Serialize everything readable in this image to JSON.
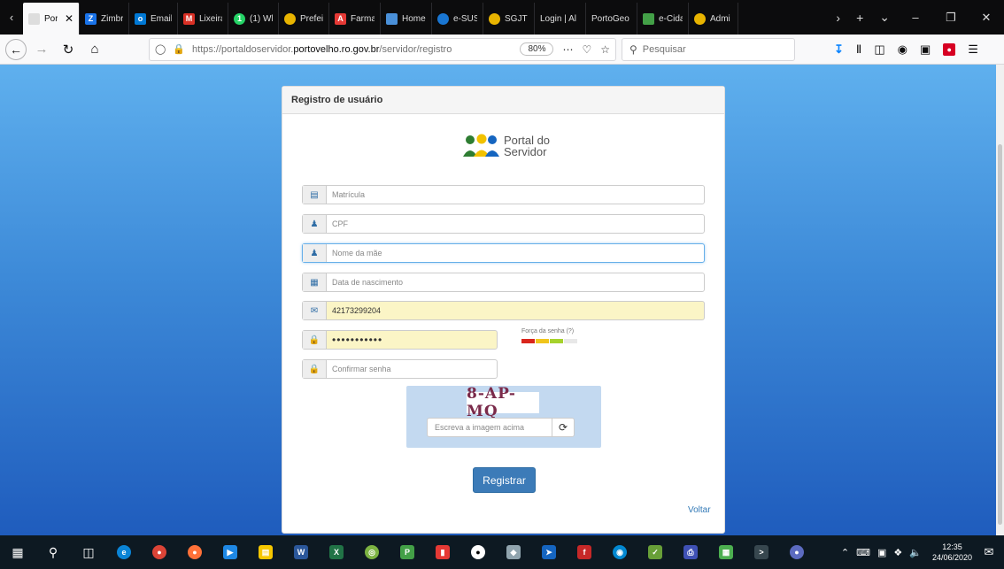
{
  "browser": {
    "tabs": [
      {
        "label": "Portal",
        "icon": "portal-icon",
        "active": true,
        "fav_color": "#f9f9fa"
      },
      {
        "label": "Zimbr",
        "icon": "zimbra-icon",
        "fav_color": "#1a73e8"
      },
      {
        "label": "Email",
        "icon": "outlook-icon",
        "fav_color": "#0078d4"
      },
      {
        "label": "Lixeira",
        "icon": "gmail-icon",
        "fav_color": "#d93025"
      },
      {
        "label": "(1) Wh",
        "icon": "whatsapp-icon",
        "fav_color": "#25d366"
      },
      {
        "label": "Prefei",
        "icon": "prefeitura-icon",
        "fav_color": "#e8b400"
      },
      {
        "label": "Farma",
        "icon": "farma-icon",
        "fav_color": "#e53935"
      },
      {
        "label": "Home",
        "icon": "home-doc-icon",
        "fav_color": "#4a90d9"
      },
      {
        "label": "e-SUS",
        "icon": "esus-icon",
        "fav_color": "#1976d2"
      },
      {
        "label": "SGJT",
        "icon": "sgjt-icon",
        "fav_color": "#e8b400"
      },
      {
        "label": "Login | Al",
        "icon": "",
        "fav_color": ""
      },
      {
        "label": "PortoGeo",
        "icon": "",
        "fav_color": ""
      },
      {
        "label": "e-Cida",
        "icon": "ecidade-icon",
        "fav_color": "#43a047"
      },
      {
        "label": "Admi",
        "icon": "admin-icon",
        "fav_color": "#e8b400"
      }
    ],
    "url_prefix": "https://portaldoservidor.",
    "url_domain": "portovelho.ro.gov.br",
    "url_path": "/servidor/registro",
    "zoom": "80%",
    "search_placeholder": "Pesquisar"
  },
  "page": {
    "card_title": "Registro de usuário",
    "logo_line1": "Portal do",
    "logo_line2": "Servidor",
    "fields": {
      "matricula_placeholder": "Matrícula",
      "cpf_placeholder": "CPF",
      "mae_placeholder": "Nome da mãe",
      "nascimento_placeholder": "Data de nascimento",
      "email_value": "42173299204",
      "senha_value": "12345678901",
      "confirmar_placeholder": "Confirmar senha"
    },
    "strength_label": "Força da senha (?)",
    "strength_levels": 3,
    "strength_colors": [
      "#d9251c",
      "#f0c51c",
      "#a6d22c",
      "#e8e8e8"
    ],
    "captcha_text": "8-AP-MQ",
    "captcha_placeholder": "Escreva a imagem acima",
    "register_label": "Registrar",
    "back_label": "Voltar"
  },
  "taskbar": {
    "time": "12:35",
    "date": "24/06/2020"
  },
  "colors": {
    "primary": "#3c7bb8",
    "link": "#337ab7",
    "autofill": "#fbf5c6"
  }
}
